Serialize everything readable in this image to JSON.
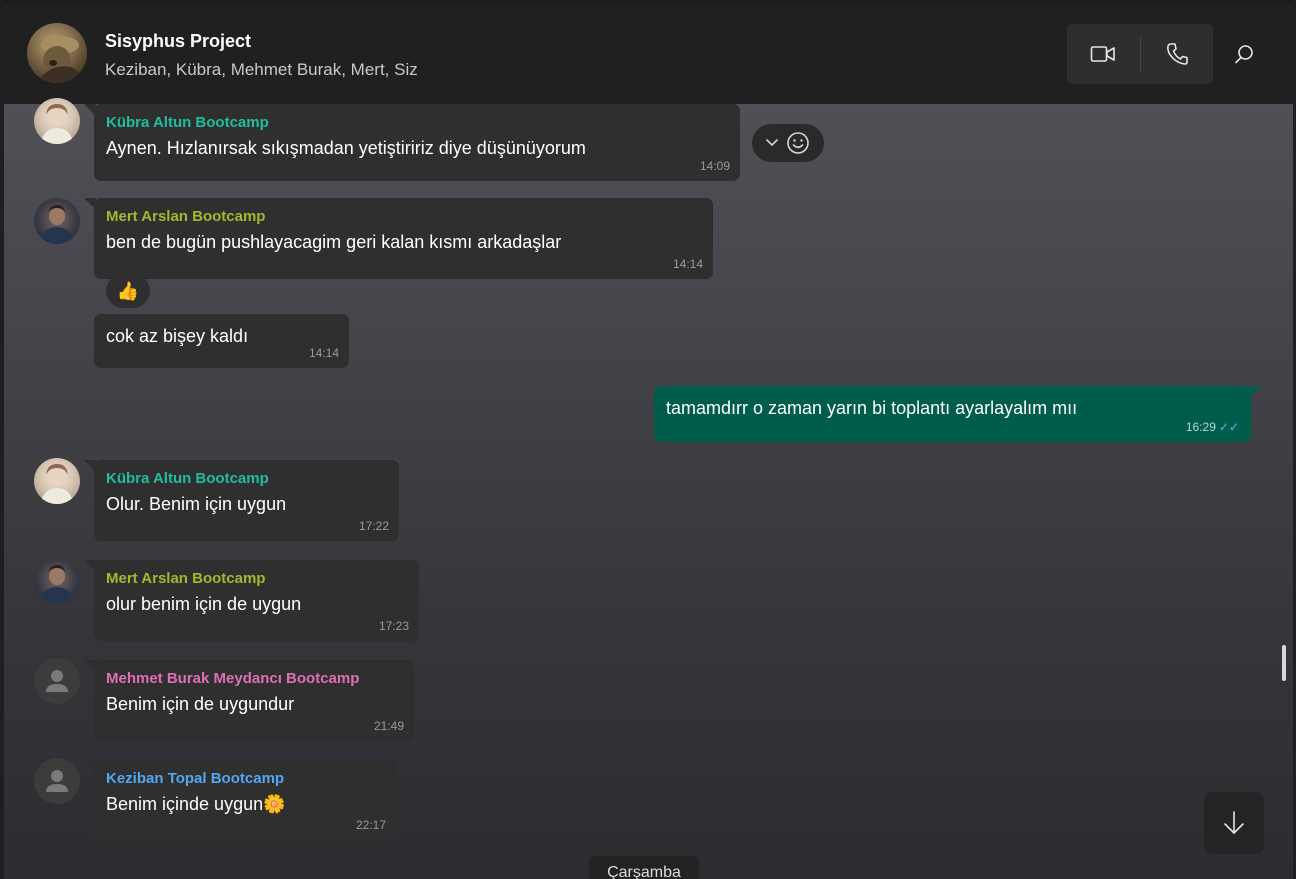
{
  "header": {
    "title": "Sisyphus Project",
    "members": "Keziban, Kübra, Mehmet Burak, Mert, Siz",
    "video_icon": "video-camera-icon",
    "phone_icon": "phone-icon",
    "search_icon": "search-icon"
  },
  "messages": [
    {
      "sender": "Kübra Altun Bootcamp",
      "sender_color": "#1cbf9f",
      "text": "Aynen. Hızlanırsak sıkışmadan yetiştiririz diye düşünüyorum",
      "time": "14:09",
      "avatar": "kubra"
    },
    {
      "sender": "Mert Arslan Bootcamp",
      "sender_color": "#a5b72c",
      "text": "ben de bugün pushlayacagim geri kalan kısmı arkadaşlar",
      "time": "14:14",
      "avatar": "mert",
      "reaction": "👍"
    },
    {
      "sender": "",
      "text": "cok az bişey kaldı",
      "time": "14:14"
    },
    {
      "sender": "",
      "text": "tamamdırr o zaman yarın bi toplantı ayarlayalım mıı",
      "time": "16:29",
      "outgoing": true,
      "checks": "✓✓"
    },
    {
      "sender": "Kübra Altun Bootcamp",
      "sender_color": "#1cbf9f",
      "text": "Olur. Benim için uygun",
      "time": "17:22",
      "avatar": "kubra"
    },
    {
      "sender": "Mert Arslan Bootcamp",
      "sender_color": "#a5b72c",
      "text": "olur benim için de uygun",
      "time": "17:23",
      "avatar": "mert"
    },
    {
      "sender": "Mehmet Burak Meydancı Bootcamp",
      "sender_color": "#df6fb4",
      "text": "Benim için de uygundur",
      "time": "21:49",
      "avatar": "default"
    },
    {
      "sender": "Keziban Topal Bootcamp",
      "sender_color": "#53a6f0",
      "text": "Benim içinde uygun🌼",
      "time": "22:17",
      "avatar": "default"
    }
  ],
  "date_chip": "Çarşamba",
  "colors": {
    "incoming_bubble": "#2f2f2f",
    "outgoing_bubble": "#005c4b",
    "read_checks": "#53bdeb"
  }
}
